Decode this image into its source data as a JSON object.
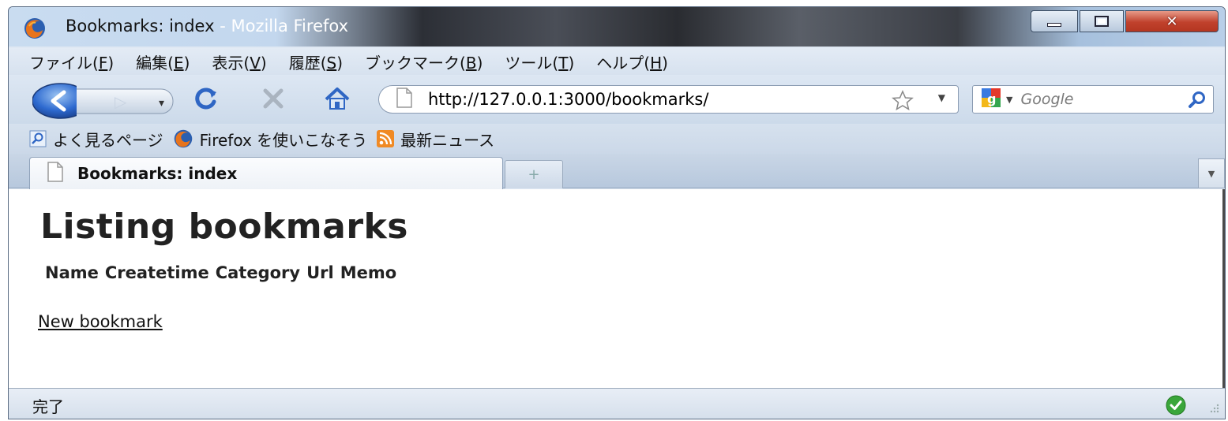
{
  "window": {
    "title_prefix": "Bookmarks: index ",
    "title_suffix": "- Mozilla Firefox"
  },
  "menubar": {
    "items": [
      {
        "text": "ファイル(",
        "key": "F",
        "close": ")"
      },
      {
        "text": "編集(",
        "key": "E",
        "close": ")"
      },
      {
        "text": "表示(",
        "key": "V",
        "close": ")"
      },
      {
        "text": "履歴(",
        "key": "S",
        "close": ")"
      },
      {
        "text": "ブックマーク(",
        "key": "B",
        "close": ")"
      },
      {
        "text": "ツール(",
        "key": "T",
        "close": ")"
      },
      {
        "text": "ヘルプ(",
        "key": "H",
        "close": ")"
      }
    ]
  },
  "navbar": {
    "url": "http://127.0.0.1:3000/bookmarks/",
    "search_placeholder": "Google"
  },
  "bookmarks_toolbar": {
    "items": [
      "よく見るページ",
      "Firefox を使いこなそう",
      "最新ニュース"
    ]
  },
  "tabs": {
    "active_title": "Bookmarks: index",
    "new_tab_symbol": "+"
  },
  "page": {
    "heading": "Listing bookmarks",
    "columns": [
      "Name",
      "Createtime",
      "Category",
      "Url",
      "Memo"
    ],
    "new_link": "New bookmark"
  },
  "statusbar": {
    "text": "完了"
  },
  "colors": {
    "accent": "#3a6fbf",
    "close_button": "#c0412c",
    "ok_green": "#3aa63a"
  }
}
